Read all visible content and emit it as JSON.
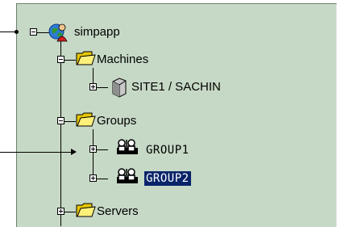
{
  "tree": {
    "root": {
      "label": "simpapp",
      "icon": "globe-person-icon",
      "expanded": true
    },
    "machines": {
      "label": "Machines",
      "icon": "folder-icon",
      "expanded": true
    },
    "site": {
      "label": "SITE1 / SACHIN",
      "icon": "server-icon",
      "expanded": false
    },
    "groups": {
      "label": "Groups",
      "icon": "folder-icon",
      "expanded": true
    },
    "group1": {
      "label": "GROUP1",
      "icon": "group-icon",
      "expanded": false
    },
    "group2": {
      "label": "GROUP2",
      "icon": "group-icon",
      "expanded": false,
      "selected": true
    },
    "servers": {
      "label": "Servers",
      "icon": "folder-icon",
      "expanded": false
    }
  },
  "colors": {
    "panel_bg": "#c6d9c6",
    "selection": "#0a246a",
    "selection_text": "#ffffff"
  }
}
